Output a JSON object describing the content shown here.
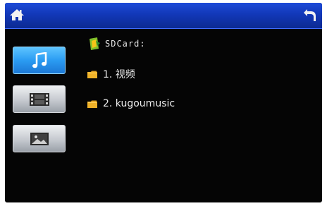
{
  "titlebar": {
    "home_icon": "home-icon",
    "back_icon": "back-arrow-icon",
    "accent": "#1238b8"
  },
  "sidebar": {
    "items": [
      {
        "name": "music",
        "icon": "music-note-icon",
        "state": "active"
      },
      {
        "name": "video",
        "icon": "film-icon",
        "state": "normal"
      },
      {
        "name": "photo",
        "icon": "picture-icon",
        "state": "normal"
      }
    ],
    "active_color": "#2b9cf2"
  },
  "browser": {
    "drive_label": "SDCard:",
    "items": [
      {
        "label": "1.  视频",
        "icon": "folder-icon"
      },
      {
        "label": "2.  kugoumusic",
        "icon": "folder-icon"
      }
    ]
  }
}
